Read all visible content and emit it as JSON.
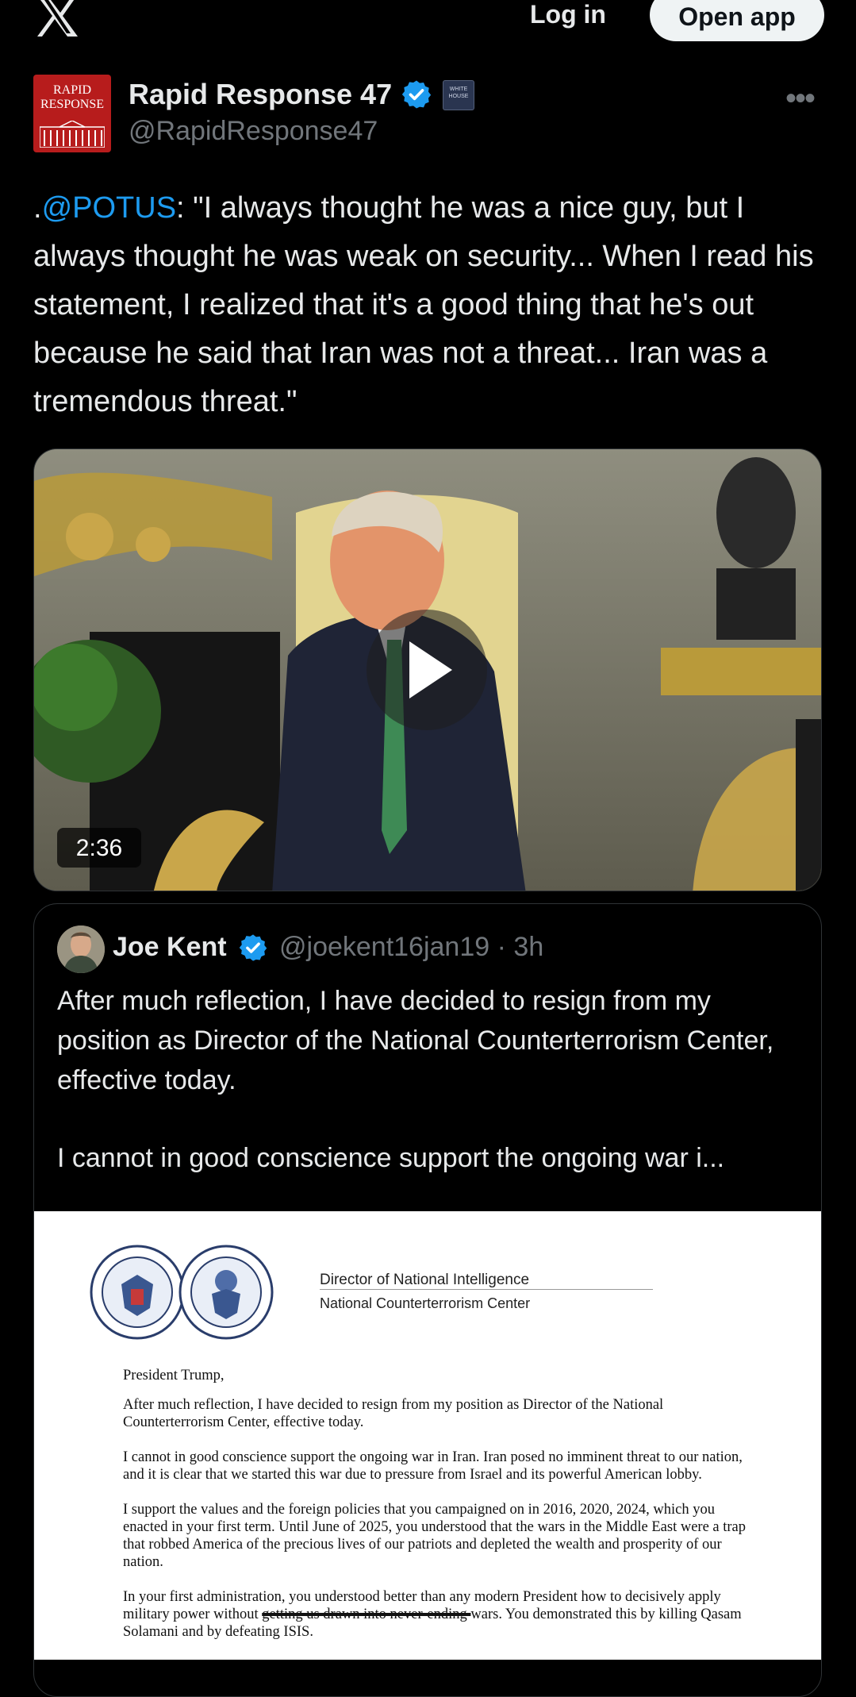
{
  "header": {
    "login_label": "Log in",
    "open_app_label": "Open app"
  },
  "post": {
    "author_name": "Rapid Response 47",
    "handle": "@RapidResponse47",
    "avatar_line1": "RAPID",
    "avatar_line2": "RESPONSE",
    "affiliation_badge": "WHITE HOUSE",
    "text_mention": "@POTUS",
    "text_prefix": ".",
    "text_body": ": \"I always thought he was a nice guy, but I always thought he was weak on security... When I read his statement, I realized that it's a good thing that he's out because he said that Iran was not a threat... Iran was a tremendous threat.\"",
    "video_duration": "2:36"
  },
  "quoted_post": {
    "author_name": "Joe Kent",
    "handle": "@joekent16jan19",
    "separator": "·",
    "time_ago": "3h",
    "text_para1": "After much reflection, I have decided to resign from my position as Director of the National Counterterrorism Center, effective today.",
    "text_para2": "I cannot in good conscience support the ongoing war i..."
  },
  "letter": {
    "org1": "Director of National Intelligence",
    "org2": "National Counterterrorism Center",
    "salutation": "President Trump,",
    "para1": "After much reflection, I have decided to resign from my position as Director of the National Counterterrorism Center, effective today.",
    "para2": "I cannot in good conscience support the ongoing war in Iran. Iran posed no imminent threat to our nation, and it is clear that we started this war due to pressure from Israel and its powerful American lobby.",
    "para3": "I support the values and the foreign policies that you campaigned on in 2016, 2020, 2024, which you enacted in your first term. Until June of 2025, you understood that the wars in the Middle East were a trap that robbed America of the precious lives of our patriots and depleted the wealth and prosperity of our nation.",
    "para4_a": "In your first administration, you understood better than any modern President how to decisively apply military power without ",
    "para4_strike": "getting us drawn into never-ending ",
    "para4_b": "wars. You demonstrated this by killing Qasam Solamani and by defeating ISIS."
  },
  "colors": {
    "background": "#000000",
    "link": "#1d9bf0",
    "verified": "#1d9bf0",
    "muted": "#71767b"
  }
}
